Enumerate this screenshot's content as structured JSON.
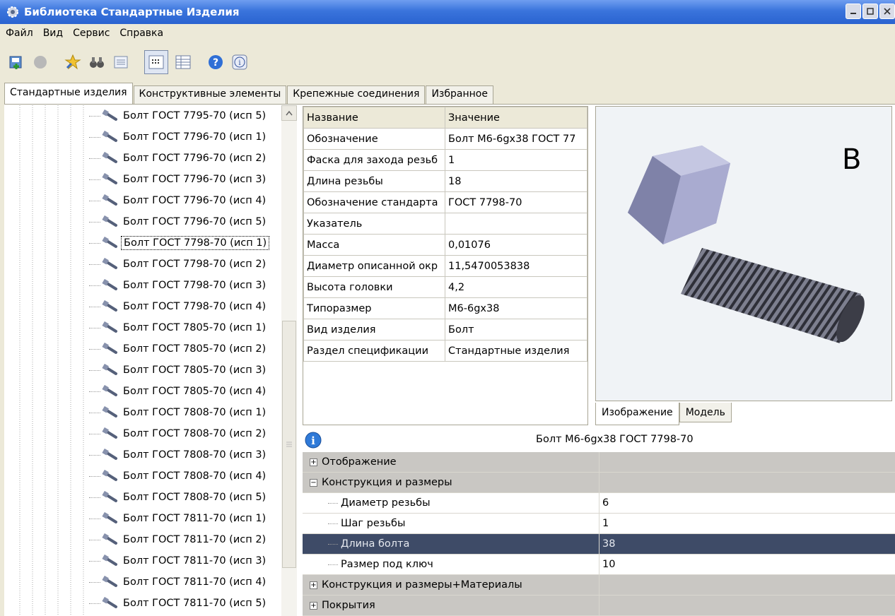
{
  "window": {
    "title": "Библиотека Стандартные Изделия"
  },
  "menu": [
    "Файл",
    "Вид",
    "Сервис",
    "Справка"
  ],
  "tabs": [
    "Стандартные изделия",
    "Конструктивные элементы",
    "Крепежные соединения",
    "Избранное"
  ],
  "tree": {
    "items": [
      "Болт ГОСТ 7795-70 (исп 5)",
      "Болт ГОСТ 7796-70 (исп 1)",
      "Болт ГОСТ 7796-70 (исп 2)",
      "Болт ГОСТ 7796-70 (исп 3)",
      "Болт ГОСТ 7796-70 (исп 4)",
      "Болт ГОСТ 7796-70 (исп 5)",
      "Болт ГОСТ 7798-70 (исп 1)",
      "Болт ГОСТ 7798-70 (исп 2)",
      "Болт ГОСТ 7798-70 (исп 3)",
      "Болт ГОСТ 7798-70 (исп 4)",
      "Болт ГОСТ 7805-70 (исп 1)",
      "Болт ГОСТ 7805-70 (исп 2)",
      "Болт ГОСТ 7805-70 (исп 3)",
      "Болт ГОСТ 7805-70 (исп 4)",
      "Болт ГОСТ 7808-70 (исп 1)",
      "Болт ГОСТ 7808-70 (исп 2)",
      "Болт ГОСТ 7808-70 (исп 3)",
      "Болт ГОСТ 7808-70 (исп 4)",
      "Болт ГОСТ 7808-70 (исп 5)",
      "Болт ГОСТ 7811-70 (исп 1)",
      "Болт ГОСТ 7811-70 (исп 2)",
      "Болт ГОСТ 7811-70 (исп 3)",
      "Болт ГОСТ 7811-70 (исп 4)",
      "Болт ГОСТ 7811-70 (исп 5)"
    ],
    "selected_index": 6
  },
  "props": {
    "headers": [
      "Название",
      "Значение"
    ],
    "rows": [
      [
        "Обозначение",
        "Болт М6-6gx38 ГОСТ 77"
      ],
      [
        "Фаска для захода резьб",
        "1"
      ],
      [
        "Длина резьбы",
        "18"
      ],
      [
        "Обозначение стандарта",
        "ГОСТ 7798-70"
      ],
      [
        "Указатель",
        ""
      ],
      [
        "Масса",
        "0,01076"
      ],
      [
        "Диаметр описанной окр",
        "11,5470053838"
      ],
      [
        "Высота головки",
        "4,2"
      ],
      [
        "Типоразмер",
        "М6-6gx38"
      ],
      [
        "Вид изделия",
        "Болт"
      ],
      [
        "Раздел спецификации",
        "Стандартные изделия"
      ]
    ]
  },
  "preview": {
    "letter": "B",
    "tabs": [
      "Изображение",
      "Модель"
    ]
  },
  "details": {
    "title": "Болт М6-6gx38 ГОСТ 7798-70",
    "groups": [
      {
        "label": "Отображение",
        "expanded": false,
        "rows": []
      },
      {
        "label": "Конструкция и размеры",
        "expanded": true,
        "rows": [
          {
            "name": "Диаметр резьбы",
            "value": "6"
          },
          {
            "name": "Шаг резьбы",
            "value": "1"
          },
          {
            "name": "Длина болта",
            "value": "38",
            "selected": true
          },
          {
            "name": "Размер под ключ",
            "value": "10"
          }
        ]
      },
      {
        "label": "Конструкция и размеры+Материалы",
        "expanded": false,
        "rows": []
      },
      {
        "label": "Покрытия",
        "expanded": false,
        "rows": []
      }
    ]
  },
  "colors": {
    "titlebar": "#2a63d0",
    "selection": "#3e4b67",
    "group_row": "#c9c7c3"
  }
}
